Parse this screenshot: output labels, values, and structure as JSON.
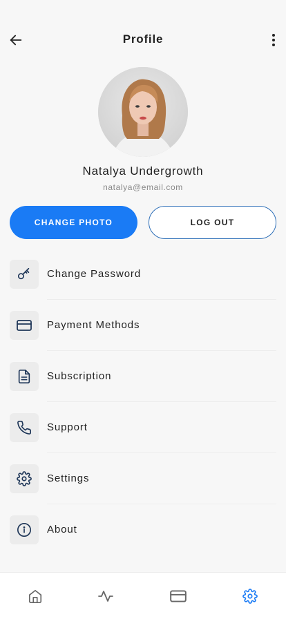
{
  "header": {
    "title": "Profile",
    "back_icon": "arrow-left-icon",
    "more_icon": "more-vertical-icon"
  },
  "profile": {
    "name": "Natalya Undergrowth",
    "email": "natalya@email.com"
  },
  "actions": {
    "change_photo_label": "CHANGE PHOTO",
    "logout_label": "LOG OUT"
  },
  "menu": {
    "items": [
      {
        "label": "Change Password",
        "icon": "key-icon"
      },
      {
        "label": "Payment Methods",
        "icon": "credit-card-icon"
      },
      {
        "label": "Subscription",
        "icon": "document-icon"
      },
      {
        "label": "Support",
        "icon": "phone-icon"
      },
      {
        "label": "Settings",
        "icon": "gear-icon"
      },
      {
        "label": "About",
        "icon": "info-icon"
      }
    ]
  },
  "tabbar": {
    "items": [
      {
        "icon": "home-icon",
        "active": false
      },
      {
        "icon": "activity-icon",
        "active": false
      },
      {
        "icon": "card-icon",
        "active": false
      },
      {
        "icon": "gear-icon",
        "active": true
      }
    ]
  },
  "colors": {
    "accent": "#1a7bf5",
    "outline": "#2e6fb8",
    "icon": "#1d3557",
    "inactive_tab": "#666666"
  }
}
